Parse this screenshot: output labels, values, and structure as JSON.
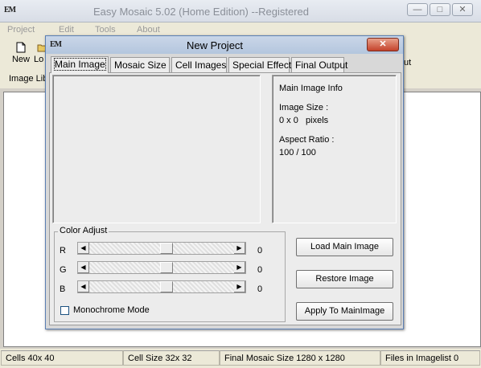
{
  "app": {
    "logo": "EM",
    "title": "Easy Mosaic 5.02 (Home Edition)  --Registered",
    "minimize": "—",
    "restore": "□",
    "close": "✕"
  },
  "menu": [
    "Project",
    "Edit",
    "Tools",
    "About"
  ],
  "toolbar": {
    "new_label": "New",
    "load_label_partial": "Lo",
    "right_partial": "ut"
  },
  "library_label_partial": "Image Lib",
  "status": {
    "cells": "Cells 40x 40",
    "cell_size": "Cell Size 32x 32",
    "final_size": "Final Mosaic Size 1280 x 1280",
    "files": "Files in Imagelist 0"
  },
  "dialog": {
    "logo": "EM",
    "title": "New Project",
    "close": "✕",
    "tabs": [
      "Main Image",
      "Mosaic Size",
      "Cell Images",
      "Special Effect",
      "Final Output"
    ],
    "active_tab": "Main Image",
    "info": {
      "heading": "Main Image Info",
      "size_label": "Image Size :",
      "size_value": "0 x 0   pixels",
      "ratio_label": "Aspect Ratio :",
      "ratio_value": "100 / 100"
    },
    "color_adjust": {
      "title": "Color Adjust",
      "sliders": [
        {
          "label": "R",
          "value": "0",
          "level": 0.5
        },
        {
          "label": "G",
          "value": "0",
          "level": 0.5
        },
        {
          "label": "B",
          "value": "0",
          "level": 0.5
        }
      ],
      "monochrome_label": "Monochrome Mode",
      "monochrome_checked": false
    },
    "buttons": {
      "load": "Load Main Image",
      "restore": "Restore Image",
      "apply": "Apply To MainImage"
    }
  }
}
